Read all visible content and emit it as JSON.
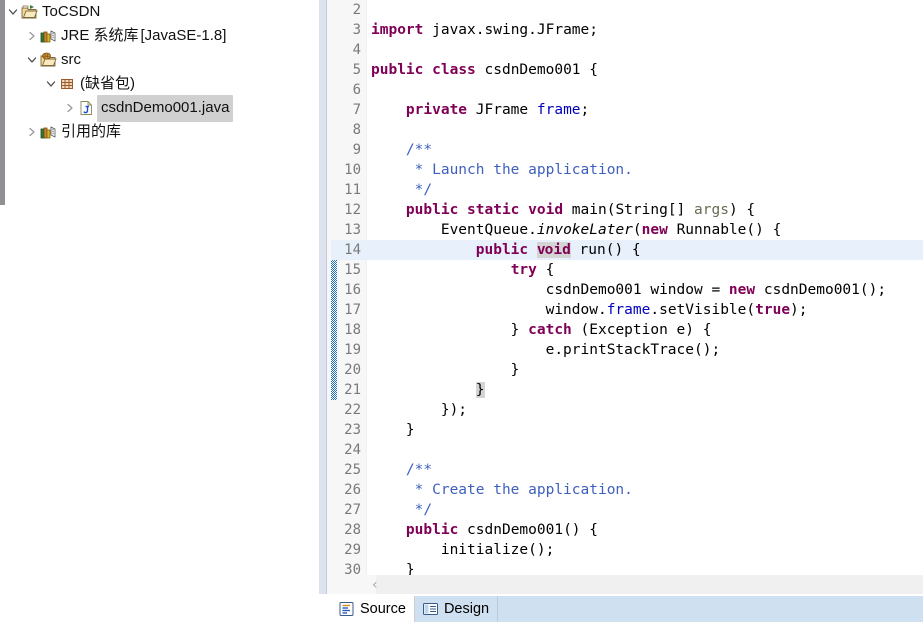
{
  "explorer": {
    "name": "package-explorer",
    "tree": [
      {
        "id": "project",
        "label": "ToCSDN",
        "suffix": "",
        "indent": 0,
        "twisty": "down",
        "icon": "project-folder-icon",
        "selected": false
      },
      {
        "id": "jre",
        "label": "JRE 系统库",
        "suffix": " [JavaSE-1.8]",
        "indent": 1,
        "twisty": "right",
        "icon": "library-books-icon",
        "selected": false
      },
      {
        "id": "src",
        "label": "src",
        "suffix": "",
        "indent": 1,
        "twisty": "down",
        "icon": "source-folder-icon",
        "selected": false
      },
      {
        "id": "default-package",
        "label": "(缺省包)",
        "suffix": "",
        "indent": 2,
        "twisty": "down",
        "icon": "package-icon",
        "selected": false
      },
      {
        "id": "java-file",
        "label": "csdnDemo001.java",
        "suffix": "",
        "indent": 3,
        "twisty": "right",
        "icon": "java-file-icon",
        "selected": true
      },
      {
        "id": "referenced-libraries",
        "label": "引用的库",
        "suffix": "",
        "indent": 1,
        "twisty": "right",
        "icon": "library-books-icon",
        "selected": false
      }
    ]
  },
  "editor": {
    "name": "java-source-editor",
    "current_line": 14,
    "first_visible_line": 2,
    "change_bar_lines": [
      14,
      15,
      16,
      17,
      18,
      19,
      20,
      21
    ],
    "fold_marker_line": 14,
    "lines": [
      {
        "n": 2,
        "tokens": []
      },
      {
        "n": 3,
        "tokens": [
          {
            "t": "import",
            "c": "kw"
          },
          {
            "t": " javax.swing.JFrame;",
            "c": "pl"
          }
        ]
      },
      {
        "n": 4,
        "tokens": []
      },
      {
        "n": 5,
        "tokens": [
          {
            "t": "public",
            "c": "kw"
          },
          {
            "t": " ",
            "c": "pl"
          },
          {
            "t": "class",
            "c": "kw"
          },
          {
            "t": " csdnDemo001 {",
            "c": "pl"
          }
        ]
      },
      {
        "n": 6,
        "tokens": []
      },
      {
        "n": 7,
        "tokens": [
          {
            "t": "    ",
            "c": "pl"
          },
          {
            "t": "private",
            "c": "kw"
          },
          {
            "t": " JFrame ",
            "c": "pl"
          },
          {
            "t": "frame",
            "c": "fld"
          },
          {
            "t": ";",
            "c": "pl"
          }
        ]
      },
      {
        "n": 8,
        "tokens": []
      },
      {
        "n": 9,
        "tokens": [
          {
            "t": "    /**",
            "c": "cm"
          }
        ]
      },
      {
        "n": 10,
        "tokens": [
          {
            "t": "     * Launch the application.",
            "c": "cm"
          }
        ]
      },
      {
        "n": 11,
        "tokens": [
          {
            "t": "     */",
            "c": "cm"
          }
        ]
      },
      {
        "n": 12,
        "tokens": [
          {
            "t": "    ",
            "c": "pl"
          },
          {
            "t": "public static void",
            "c": "kw"
          },
          {
            "t": " main(String[] ",
            "c": "pl"
          },
          {
            "t": "args",
            "c": "par"
          },
          {
            "t": ") {",
            "c": "pl"
          }
        ]
      },
      {
        "n": 13,
        "tokens": [
          {
            "t": "        EventQueue.",
            "c": "pl"
          },
          {
            "t": "invokeLater",
            "c": "st"
          },
          {
            "t": "(",
            "c": "pl"
          },
          {
            "t": "new",
            "c": "kw"
          },
          {
            "t": " Runnable() {",
            "c": "pl"
          }
        ]
      },
      {
        "n": 14,
        "tokens": [
          {
            "t": "            ",
            "c": "pl"
          },
          {
            "t": "public",
            "c": "kw"
          },
          {
            "t": " ",
            "c": "pl"
          },
          {
            "t": "v",
            "c": "kw occ"
          },
          {
            "t": "CARET",
            "c": "caret"
          },
          {
            "t": "oid",
            "c": "kw occ"
          },
          {
            "t": " run() {",
            "c": "pl"
          }
        ]
      },
      {
        "n": 15,
        "tokens": [
          {
            "t": "                ",
            "c": "pl"
          },
          {
            "t": "try",
            "c": "kw"
          },
          {
            "t": " {",
            "c": "pl"
          }
        ]
      },
      {
        "n": 16,
        "tokens": [
          {
            "t": "                    csdnDemo001 window = ",
            "c": "pl"
          },
          {
            "t": "new",
            "c": "kw"
          },
          {
            "t": " csdnDemo001();",
            "c": "pl"
          }
        ]
      },
      {
        "n": 17,
        "tokens": [
          {
            "t": "                    window.",
            "c": "pl"
          },
          {
            "t": "frame",
            "c": "fld"
          },
          {
            "t": ".setVisible(",
            "c": "pl"
          },
          {
            "t": "true",
            "c": "kw"
          },
          {
            "t": ");",
            "c": "pl"
          }
        ]
      },
      {
        "n": 18,
        "tokens": [
          {
            "t": "                } ",
            "c": "pl"
          },
          {
            "t": "catch",
            "c": "kw"
          },
          {
            "t": " (Exception e) {",
            "c": "pl"
          }
        ]
      },
      {
        "n": 19,
        "tokens": [
          {
            "t": "                    e.printStackTrace();",
            "c": "pl"
          }
        ]
      },
      {
        "n": 20,
        "tokens": [
          {
            "t": "                }",
            "c": "pl"
          }
        ]
      },
      {
        "n": 21,
        "tokens": [
          {
            "t": "            ",
            "c": "pl"
          },
          {
            "t": "}",
            "c": "pl brk"
          }
        ]
      },
      {
        "n": 22,
        "tokens": [
          {
            "t": "        });",
            "c": "pl"
          }
        ]
      },
      {
        "n": 23,
        "tokens": [
          {
            "t": "    }",
            "c": "pl"
          }
        ]
      },
      {
        "n": 24,
        "tokens": []
      },
      {
        "n": 25,
        "tokens": [
          {
            "t": "    /**",
            "c": "cm"
          }
        ]
      },
      {
        "n": 26,
        "tokens": [
          {
            "t": "     * Create the application.",
            "c": "cm"
          }
        ]
      },
      {
        "n": 27,
        "tokens": [
          {
            "t": "     */",
            "c": "cm"
          }
        ]
      },
      {
        "n": 28,
        "tokens": [
          {
            "t": "    ",
            "c": "pl"
          },
          {
            "t": "public",
            "c": "kw"
          },
          {
            "t": " csdnDemo001() {",
            "c": "pl"
          }
        ]
      },
      {
        "n": 29,
        "tokens": [
          {
            "t": "        initialize();",
            "c": "pl"
          }
        ]
      },
      {
        "n": 30,
        "tokens": [
          {
            "t": "    }",
            "c": "pl"
          }
        ]
      }
    ]
  },
  "scrollbar": {
    "horizontal_left_arrow": "‹"
  },
  "bottom_tabs": [
    {
      "id": "source",
      "label": "Source",
      "icon": "source-tab-icon",
      "active": true
    },
    {
      "id": "design",
      "label": "Design",
      "icon": "design-tab-icon",
      "active": false
    }
  ],
  "colors": {
    "keyword": "#7f0055",
    "comment": "#3f5fbf",
    "field": "#0000c0",
    "parameter": "#6a6a50",
    "current_line": "#e8f0fb",
    "selection_occurrence": "#d4d4d4",
    "tab_inactive": "#cfe0f0",
    "change_bar": "#1f6fc4"
  }
}
